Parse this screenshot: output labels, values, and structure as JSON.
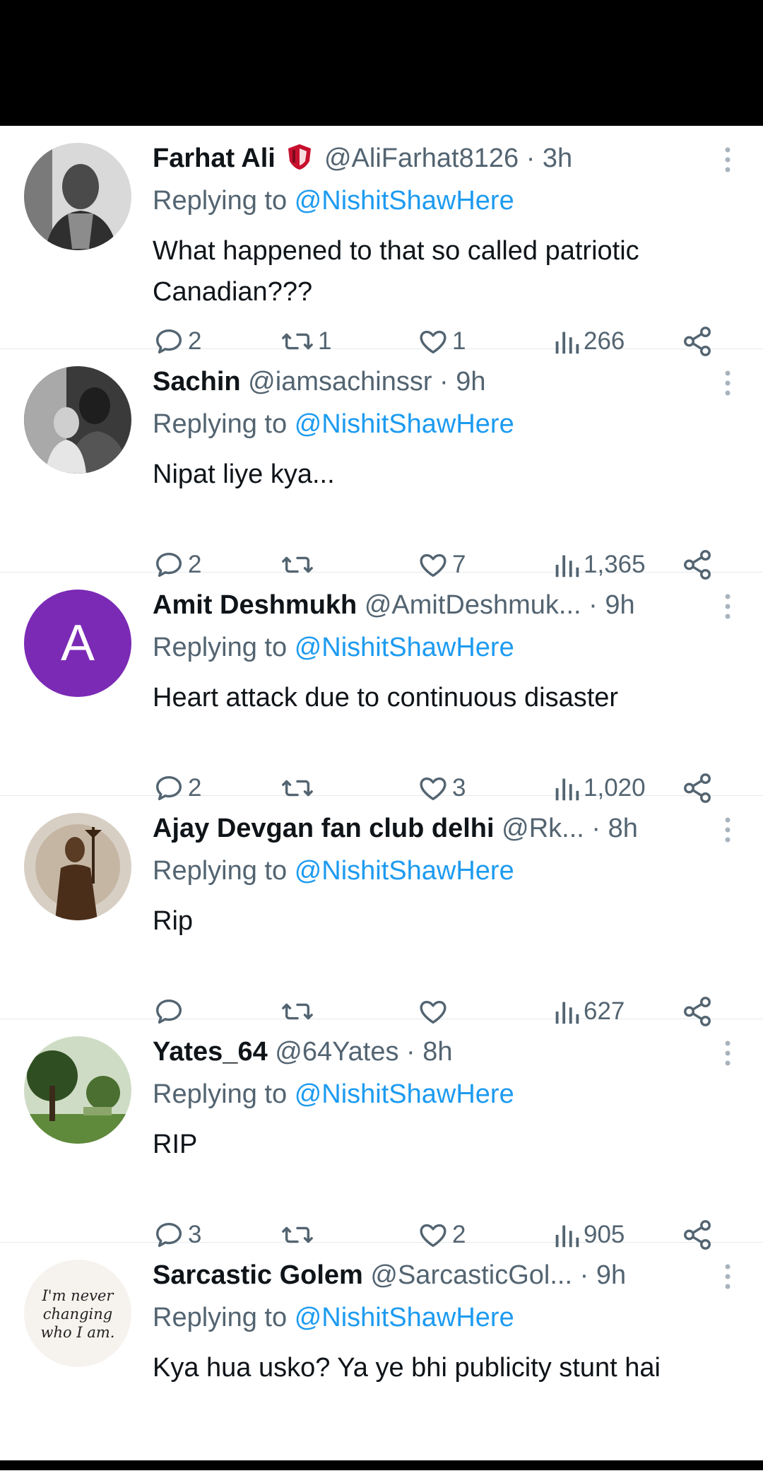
{
  "replies": [
    {
      "name": "Farhat Ali",
      "handle": "@AliFarhat8126",
      "time": "3h",
      "replying_label": "Replying to",
      "replying_to": "@NishitShawHere",
      "text": "What happened to that so called patriotic Canadian???",
      "counts": {
        "replies": "2",
        "retweets": "1",
        "likes": "1",
        "views": "266"
      }
    },
    {
      "name": "Sachin",
      "handle": "@iamsachinssr",
      "time": "9h",
      "replying_label": "Replying to",
      "replying_to": "@NishitShawHere",
      "text": "Nipat liye kya...",
      "counts": {
        "replies": "2",
        "retweets": "",
        "likes": "7",
        "views": "1,365"
      }
    },
    {
      "name": "Amit Deshmukh",
      "handle": "@AmitDeshmuk...",
      "time": "9h",
      "avatar_letter": "A",
      "avatar_color": "#7b2ab5",
      "replying_label": "Replying to",
      "replying_to": "@NishitShawHere",
      "text": "Heart attack due to continuous disaster",
      "counts": {
        "replies": "2",
        "retweets": "",
        "likes": "3",
        "views": "1,020"
      }
    },
    {
      "name": "Ajay Devgan fan club delhi",
      "handle": "@Rk...",
      "time": "8h",
      "replying_label": "Replying to",
      "replying_to": "@NishitShawHere",
      "text": "Rip",
      "counts": {
        "replies": "",
        "retweets": "",
        "likes": "",
        "views": "627"
      }
    },
    {
      "name": "Yates_64",
      "handle": "@64Yates",
      "time": "8h",
      "replying_label": "Replying to",
      "replying_to": "@NishitShawHere",
      "text": "RIP",
      "counts": {
        "replies": "3",
        "retweets": "",
        "likes": "2",
        "views": "905"
      }
    },
    {
      "name": "Sarcastic Golem",
      "handle": "@SarcasticGol...",
      "time": "9h",
      "avatar_text": [
        "I'm never",
        "changing",
        "who I am."
      ],
      "replying_label": "Replying to",
      "replying_to": "@NishitShawHere",
      "text": "Kya hua usko? Ya ye bhi publicity stunt hai",
      "counts": {
        "replies": "",
        "retweets": "",
        "likes": "",
        "views": ""
      }
    }
  ],
  "colors": {
    "link": "#1d9bf0",
    "secondary": "#536471",
    "text": "#0f1419",
    "badge": "#c8102e"
  }
}
